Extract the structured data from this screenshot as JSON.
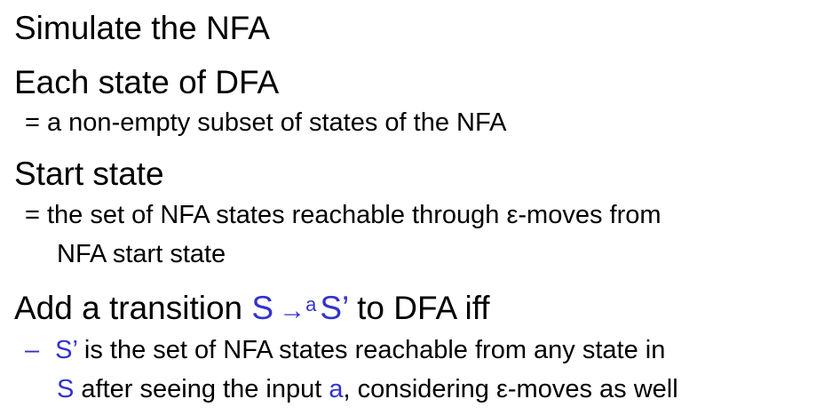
{
  "colors": {
    "text": "#000000",
    "accent": "#3333cc",
    "background": "#ffffff"
  },
  "bullets": [
    {
      "heading": "Simulate the NFA"
    },
    {
      "heading": "Each state of DFA",
      "detail": "= a non-empty subset of states of the NFA"
    },
    {
      "heading": "Start state",
      "detail_line1": "= the set of NFA states reachable through ε-moves from",
      "detail_line2": "NFA start state"
    },
    {
      "heading_prefix": "Add a transition",
      "heading_s": "S",
      "heading_arrow": "→",
      "heading_a": "a",
      "heading_s_prime": "S’",
      "heading_suffix": "to DFA iff",
      "dash": "–",
      "detail_s_prime": "S’",
      "detail_line1_rest": "is the set of NFA states reachable from any state in",
      "detail_s": "S",
      "detail_line2_mid": "after seeing the input",
      "detail_a": "a",
      "detail_line2_end": ", considering ε-moves as well"
    }
  ]
}
